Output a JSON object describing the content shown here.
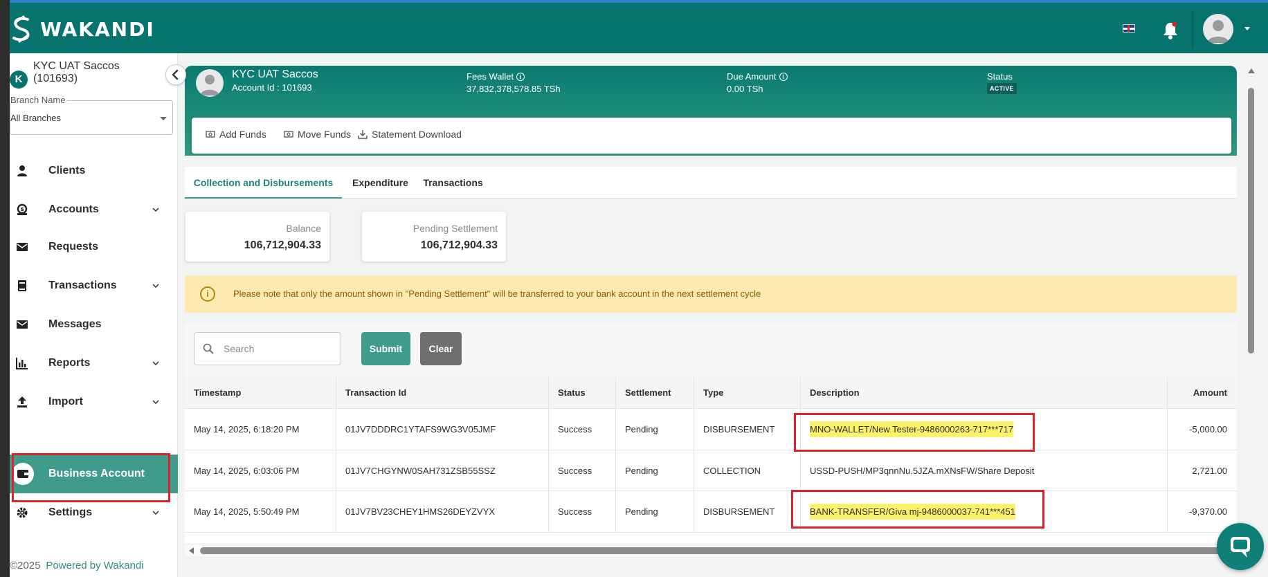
{
  "header": {
    "brand": "WAKANDI",
    "language_icon": "uk-flag-icon",
    "notification_icon": "bell-icon"
  },
  "sidebar": {
    "org_initial": "K",
    "org_name_line1": "KYC UAT Saccos",
    "org_name_line2": "(101693)",
    "branch_label": "Branch Name",
    "branch_value": "All Branches",
    "items": [
      {
        "label": "Clients",
        "icon": "user-icon",
        "has_children": false
      },
      {
        "label": "Accounts",
        "icon": "money-icon",
        "has_children": true
      },
      {
        "label": "Requests",
        "icon": "mail-icon",
        "has_children": false
      },
      {
        "label": "Transactions",
        "icon": "book-icon",
        "has_children": true
      },
      {
        "label": "Messages",
        "icon": "mail-icon",
        "has_children": false
      },
      {
        "label": "Reports",
        "icon": "bar-chart-icon",
        "has_children": true
      },
      {
        "label": "Import",
        "icon": "upload-icon",
        "has_children": true
      },
      {
        "label": "Business Account",
        "icon": "wallet-icon",
        "has_children": false,
        "active": true
      },
      {
        "label": "Settings",
        "icon": "gear-icon",
        "has_children": true
      }
    ],
    "footer_copyright": "©2025",
    "footer_powered": "Powered by Wakandi"
  },
  "account": {
    "name": "KYC UAT Saccos",
    "account_id": "Account Id : 101693",
    "fees_wallet_label": "Fees Wallet",
    "fees_wallet_value": "37,832,378,578.85 TSh",
    "due_amount_label": "Due Amount",
    "due_amount_value": "0.00 TSh",
    "status_label": "Status",
    "status_value": "ACTIVE"
  },
  "actions": {
    "add_funds": "Add Funds",
    "move_funds": "Move Funds",
    "statement_download": "Statement Download"
  },
  "tabs": [
    {
      "label": "Collection and Disbursements",
      "active": true
    },
    {
      "label": "Expenditure",
      "active": false
    },
    {
      "label": "Transactions",
      "active": false
    }
  ],
  "cards": {
    "balance_label": "Balance",
    "balance_value": "106,712,904.33",
    "pending_label": "Pending Settlement",
    "pending_value": "106,712,904.33"
  },
  "notice": "Please note that only the amount shown in \"Pending Settlement\" will be transferred to your bank account in the next settlement cycle",
  "filters": {
    "search_placeholder": "Search",
    "submit_label": "Submit",
    "clear_label": "Clear"
  },
  "table": {
    "columns": [
      "Timestamp",
      "Transaction Id",
      "Status",
      "Settlement",
      "Type",
      "Description",
      "Amount"
    ],
    "rows": [
      [
        "May 14, 2025, 6:18:20 PM",
        "01JV7DDDRC1YTAFS9WG3V05JMF",
        "Success",
        "Pending",
        "DISBURSEMENT",
        "MNO-WALLET/New Tester-9486000263-717***717",
        "-5,000.00"
      ],
      [
        "May 14, 2025, 6:03:06 PM",
        "01JV7CHGYNW0SAH731ZSB55SSZ",
        "Success",
        "Pending",
        "COLLECTION",
        "USSD-PUSH/MP3qnnNu.5JZA.mXNsFW/Share Deposit",
        "2,721.00"
      ],
      [
        "May 14, 2025, 5:50:49 PM",
        "01JV7BV23CHEY1HMS26DEYZVYX",
        "Success",
        "Pending",
        "DISBURSEMENT",
        "BANK-TRANSFER/Giva mj-9486000037-741***451",
        "-9,370.00"
      ]
    ]
  },
  "colors": {
    "primary": "#07736f",
    "accent": "#3f9c8c",
    "highlight": "#fbf16a",
    "annotation_red": "#e0212b"
  }
}
